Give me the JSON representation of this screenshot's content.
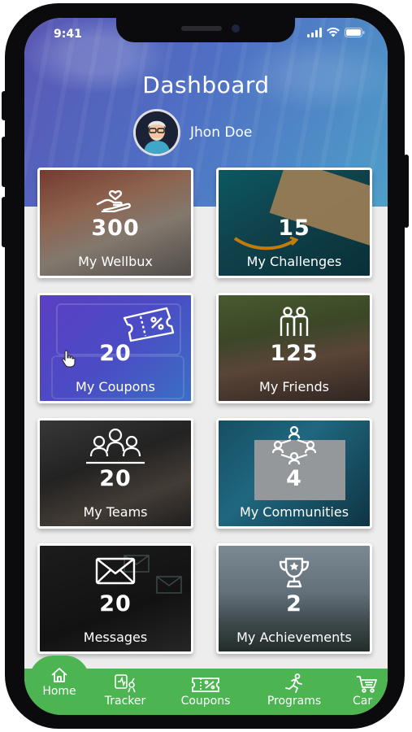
{
  "status_bar": {
    "time": "9:41"
  },
  "header": {
    "title": "Dashboard",
    "user_name": "Jhon Doe"
  },
  "tiles": [
    {
      "count": "300",
      "label": "My Wellbux",
      "icon": "hand-heart-icon"
    },
    {
      "count": "15",
      "label": "My Challenges",
      "icon": "none"
    },
    {
      "count": "20",
      "label": "My Coupons",
      "icon": "ticket-icon"
    },
    {
      "count": "125",
      "label": "My Friends",
      "icon": "people-icon"
    },
    {
      "count": "20",
      "label": "My Teams",
      "icon": "team-icon"
    },
    {
      "count": "4",
      "label": "My Communities",
      "icon": "network-icon"
    },
    {
      "count": "20",
      "label": "Messages",
      "icon": "envelope-icon"
    },
    {
      "count": "2",
      "label": "My Achievements",
      "icon": "trophy-icon"
    }
  ],
  "tabbar": {
    "items": [
      {
        "label": "Home",
        "icon": "home-icon",
        "active": true
      },
      {
        "label": "Tracker",
        "icon": "tracker-icon",
        "active": false
      },
      {
        "label": "Coupons",
        "icon": "coupon-icon",
        "active": false
      },
      {
        "label": "Programs",
        "icon": "running-icon",
        "active": false
      },
      {
        "label": "Car",
        "icon": "cart-icon",
        "active": false
      }
    ]
  },
  "colors": {
    "header_gradient_start": "#5a57b4",
    "header_gradient_end": "#4f9fc8",
    "tabbar": "#4cb450",
    "coupons_tile": "#4b3fc0"
  }
}
